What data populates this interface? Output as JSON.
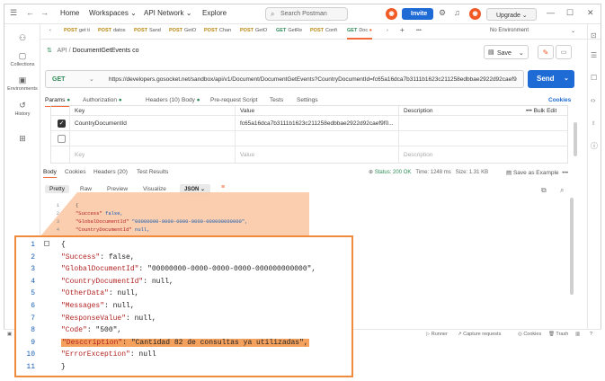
{
  "topbar": {
    "home": "Home",
    "workspaces": "Workspaces",
    "api_network": "API Network",
    "explore": "Explore",
    "search_placeholder": "Search Postman",
    "invite": "Invite",
    "upgrade": "Upgrade"
  },
  "sidebar": {
    "items": [
      {
        "label": "",
        "icon": "team-icon"
      },
      {
        "label": "Collections",
        "icon": "trash-icon"
      },
      {
        "label": "Environments",
        "icon": "env-icon"
      },
      {
        "label": "History",
        "icon": "history-icon"
      },
      {
        "label": "",
        "icon": "grid-icon"
      }
    ]
  },
  "tabs": [
    {
      "method": "POST",
      "label": "get ti"
    },
    {
      "method": "POST",
      "label": "datos"
    },
    {
      "method": "POST",
      "label": "Sand"
    },
    {
      "method": "POST",
      "label": "GetO"
    },
    {
      "method": "POST",
      "label": "Chan"
    },
    {
      "method": "POST",
      "label": "GetO"
    },
    {
      "method": "GET",
      "label": "GetRe"
    },
    {
      "method": "POST",
      "label": "Confi"
    },
    {
      "method": "GET",
      "label": "Doc"
    }
  ],
  "environment": "No Environment",
  "request": {
    "breadcrumb_root": "API",
    "name": "DocumentGetEvents co",
    "save": "Save",
    "method": "GET",
    "url": "https://developers.gosocket.net/sandbox/api/v1/Document/DocumentGetEvents?CountryDocumentId=fc65a16dca7b3111b1623c211258edbbae2922d92caef9",
    "send": "Send"
  },
  "param_tabs": {
    "params": "Params",
    "authorization": "Authorization",
    "headers": "Headers (10)",
    "body": "Body",
    "prerequest": "Pre-request Script",
    "tests": "Tests",
    "settings": "Settings",
    "cookies": "Cookies"
  },
  "params_table": {
    "headers": {
      "key": "Key",
      "value": "Value",
      "description": "Description",
      "bulk": "Bulk Edit"
    },
    "rows": [
      {
        "key": "CountryDocumentId",
        "value": "fc65a16dca7b3111b1623c211258edbbae2922d92caef9f0...",
        "description": ""
      }
    ],
    "placeholders": {
      "key": "Key",
      "value": "Value",
      "description": "Description"
    }
  },
  "response": {
    "tabs": {
      "body": "Body",
      "cookies": "Cookies",
      "headers": "Headers (20)",
      "tests": "Test Results"
    },
    "status": "Status: 200 OK",
    "time": "Time: 1248 ms",
    "size": "Size: 1.31 KB",
    "save_example": "Save as Example",
    "views": {
      "pretty": "Pretty",
      "raw": "Raw",
      "preview": "Preview",
      "visualize": "Visualize",
      "format": "JSON"
    }
  },
  "small_code": [
    {
      "n": "1",
      "text": "{"
    },
    {
      "n": "2",
      "key": "\"Success\"",
      "val": " false,"
    },
    {
      "n": "3",
      "key": "\"GlobalDocumentId\"",
      "val": " \"00000000-0000-0000-0000-000000000000\","
    },
    {
      "n": "4",
      "key": "\"CountryDocumentId\"",
      "val": " null,"
    }
  ],
  "zoom_code": [
    {
      "n": "1",
      "key": "",
      "rest": "{"
    },
    {
      "n": "2",
      "key": "\"Success\"",
      "rest": ": false,"
    },
    {
      "n": "3",
      "key": "\"GlobalDocumentId\"",
      "rest": ": \"00000000-0000-0000-0000-000000000000\","
    },
    {
      "n": "4",
      "key": "\"CountryDocumentId\"",
      "rest": ": null,"
    },
    {
      "n": "5",
      "key": "\"OtherData\"",
      "rest": ": null,"
    },
    {
      "n": "6",
      "key": "\"Messages\"",
      "rest": ": null,"
    },
    {
      "n": "7",
      "key": "\"ResponseValue\"",
      "rest": ": null,"
    },
    {
      "n": "8",
      "key": "\"Code\"",
      "rest": ": \"500\","
    },
    {
      "n": "9",
      "key": "\"Desccription\"",
      "rest": ": \"Cantidad 82 de consultas ya utilizadas\","
    },
    {
      "n": "10",
      "key": "\"ErrorException\"",
      "rest": ": null"
    },
    {
      "n": "11",
      "key": "",
      "rest": "}"
    }
  ],
  "statusbar": {
    "runner": "Runner",
    "capture": "Capture requests",
    "cookies": "Cookies",
    "trash": "Trash"
  },
  "colors": {
    "accent": "#f26b3a",
    "primary": "#1e6bd6",
    "highlight": "#f5a15e",
    "zoom_border": "#f08a3c"
  }
}
